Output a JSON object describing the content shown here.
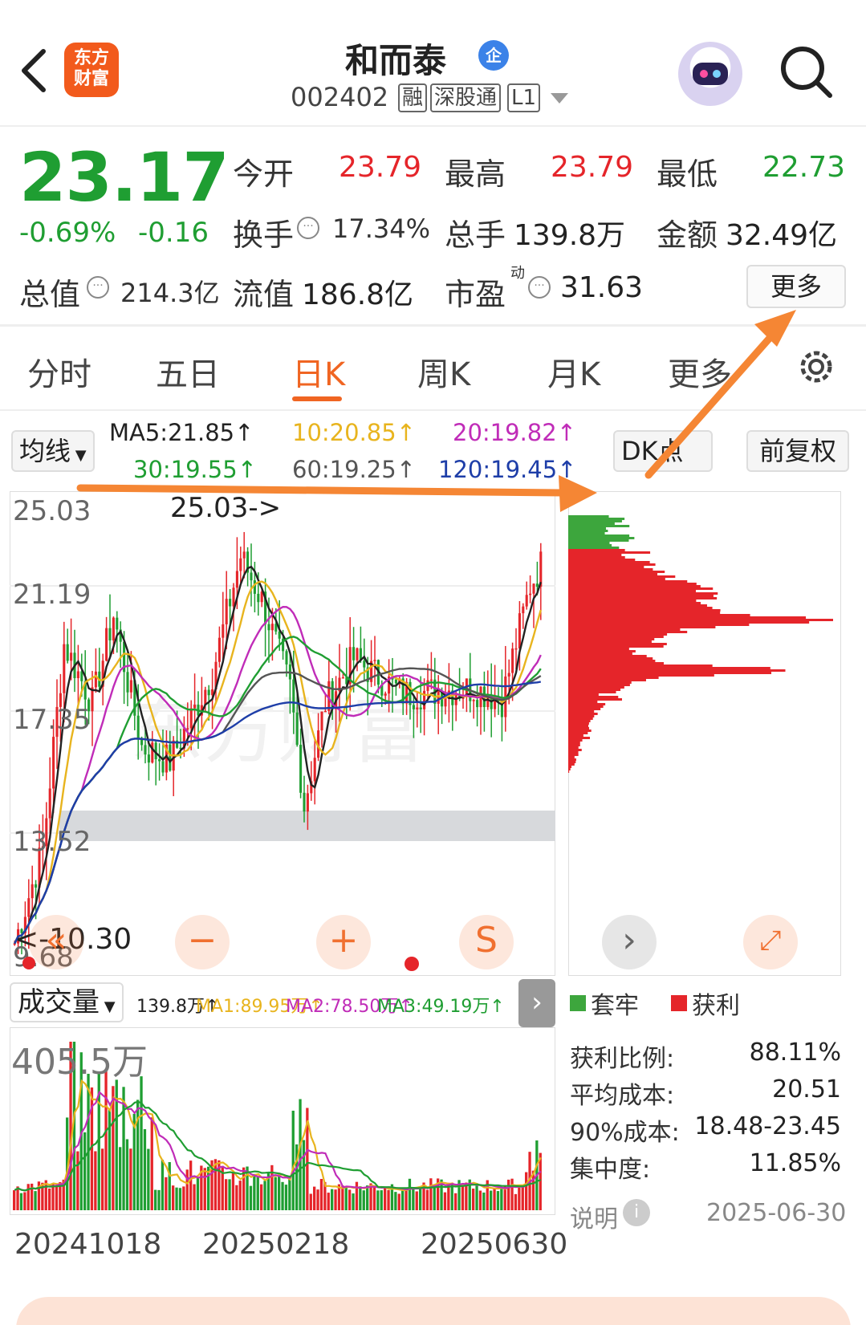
{
  "header": {
    "logo_text": "东方\n财富",
    "title": "和而泰",
    "badge": "企",
    "code": "002402",
    "tags": [
      "融",
      "深股通",
      "L1"
    ]
  },
  "quote": {
    "price": "23.17",
    "change_pct": "-0.69%",
    "change": "-0.16",
    "open_label": "今开",
    "open": "23.79",
    "high_label": "最高",
    "high": "23.79",
    "low_label": "最低",
    "low": "22.73",
    "turnover_label": "换手",
    "turnover": "17.34%",
    "volume_label": "总手",
    "volume": "139.8万",
    "amount_label": "金额",
    "amount": "32.49亿",
    "mcap_label": "总值",
    "mcap": "214.3亿",
    "float_label": "流值",
    "float": "186.8亿",
    "pe_label": "市盈",
    "pe_sup": "动",
    "pe": "31.63",
    "more_label": "更多"
  },
  "tabs": [
    {
      "label": "分时",
      "active": false
    },
    {
      "label": "五日",
      "active": false
    },
    {
      "label": "日K",
      "active": true
    },
    {
      "label": "周K",
      "active": false
    },
    {
      "label": "月K",
      "active": false
    },
    {
      "label": "更多",
      "active": false
    }
  ],
  "ma_bar": {
    "selector": "均线",
    "ma5": "MA5:21.85↑",
    "ma10": "10:20.85↑",
    "ma20": "20:19.82↑",
    "ma30": "30:19.55↑",
    "ma60": "60:19.25↑",
    "ma120": "120:19.45↑",
    "dk_label": "DK点",
    "adjust_label": "前复权",
    "colors": {
      "ma5": "#222222",
      "ma10": "#e8b41e",
      "ma20": "#c02cb8",
      "ma30": "#1f9e32",
      "ma60": "#555555",
      "ma120": "#1e3ea8"
    }
  },
  "kline": {
    "y_labels": [
      "25.03",
      "21.19",
      "17.35",
      "13.52",
      "9.68"
    ],
    "max_marker": "25.03->",
    "min_marker": "<-10.30",
    "buttons": [
      "«",
      "−",
      "+",
      "S"
    ]
  },
  "chips": {
    "legend_trapped": "套牢",
    "legend_profit": "获利",
    "stats": [
      {
        "label": "获利比例:",
        "value": "88.11%"
      },
      {
        "label": "平均成本:",
        "value": "20.51"
      },
      {
        "label": "90%成本:",
        "value": "18.48-23.45"
      },
      {
        "label": "集中度:",
        "value": "11.85%"
      }
    ],
    "note_label": "说明",
    "date": "2025-06-30",
    "colors": {
      "trapped": "#3da63d",
      "profit": "#e5252a"
    }
  },
  "volume": {
    "selector": "成交量",
    "vol": "139.8万↑",
    "ma1": "MA1:89.95万↑",
    "ma2": "MA2:78.50万↑",
    "ma3": "MA3:49.19万↑",
    "max_label": "405.5万"
  },
  "dates": [
    "20241018",
    "20250218",
    "20250630"
  ]
}
